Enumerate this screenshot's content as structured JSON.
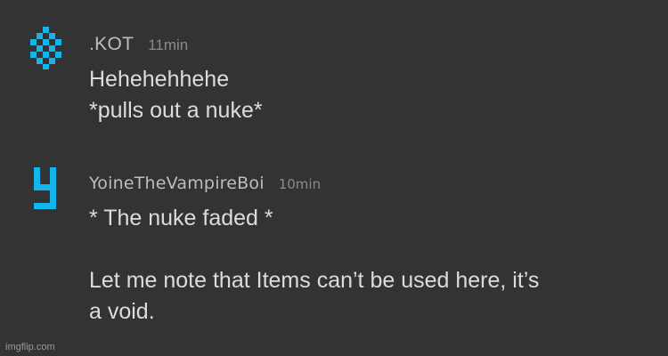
{
  "messages": [
    {
      "avatar_icon": "pixel-diamond-icon",
      "username": ".KOT",
      "time": "11min",
      "lines": [
        "Hehehehhehe",
        "*pulls out a nuke*"
      ]
    },
    {
      "avatar_icon": "pixel-y-icon",
      "username": "YoineTheVampireBoi",
      "time": "10min",
      "lines": [
        "* The nuke faded *",
        "",
        "Let me note that Items can’t be used here, it’s",
        "a void."
      ]
    }
  ],
  "watermark": "imgflip.com",
  "colors": {
    "background": "#333333",
    "avatar_accent": "#13b5ea",
    "username": "#bdbdbd",
    "timestamp": "#8a8a8a",
    "message_text": "#dcdcdc"
  }
}
